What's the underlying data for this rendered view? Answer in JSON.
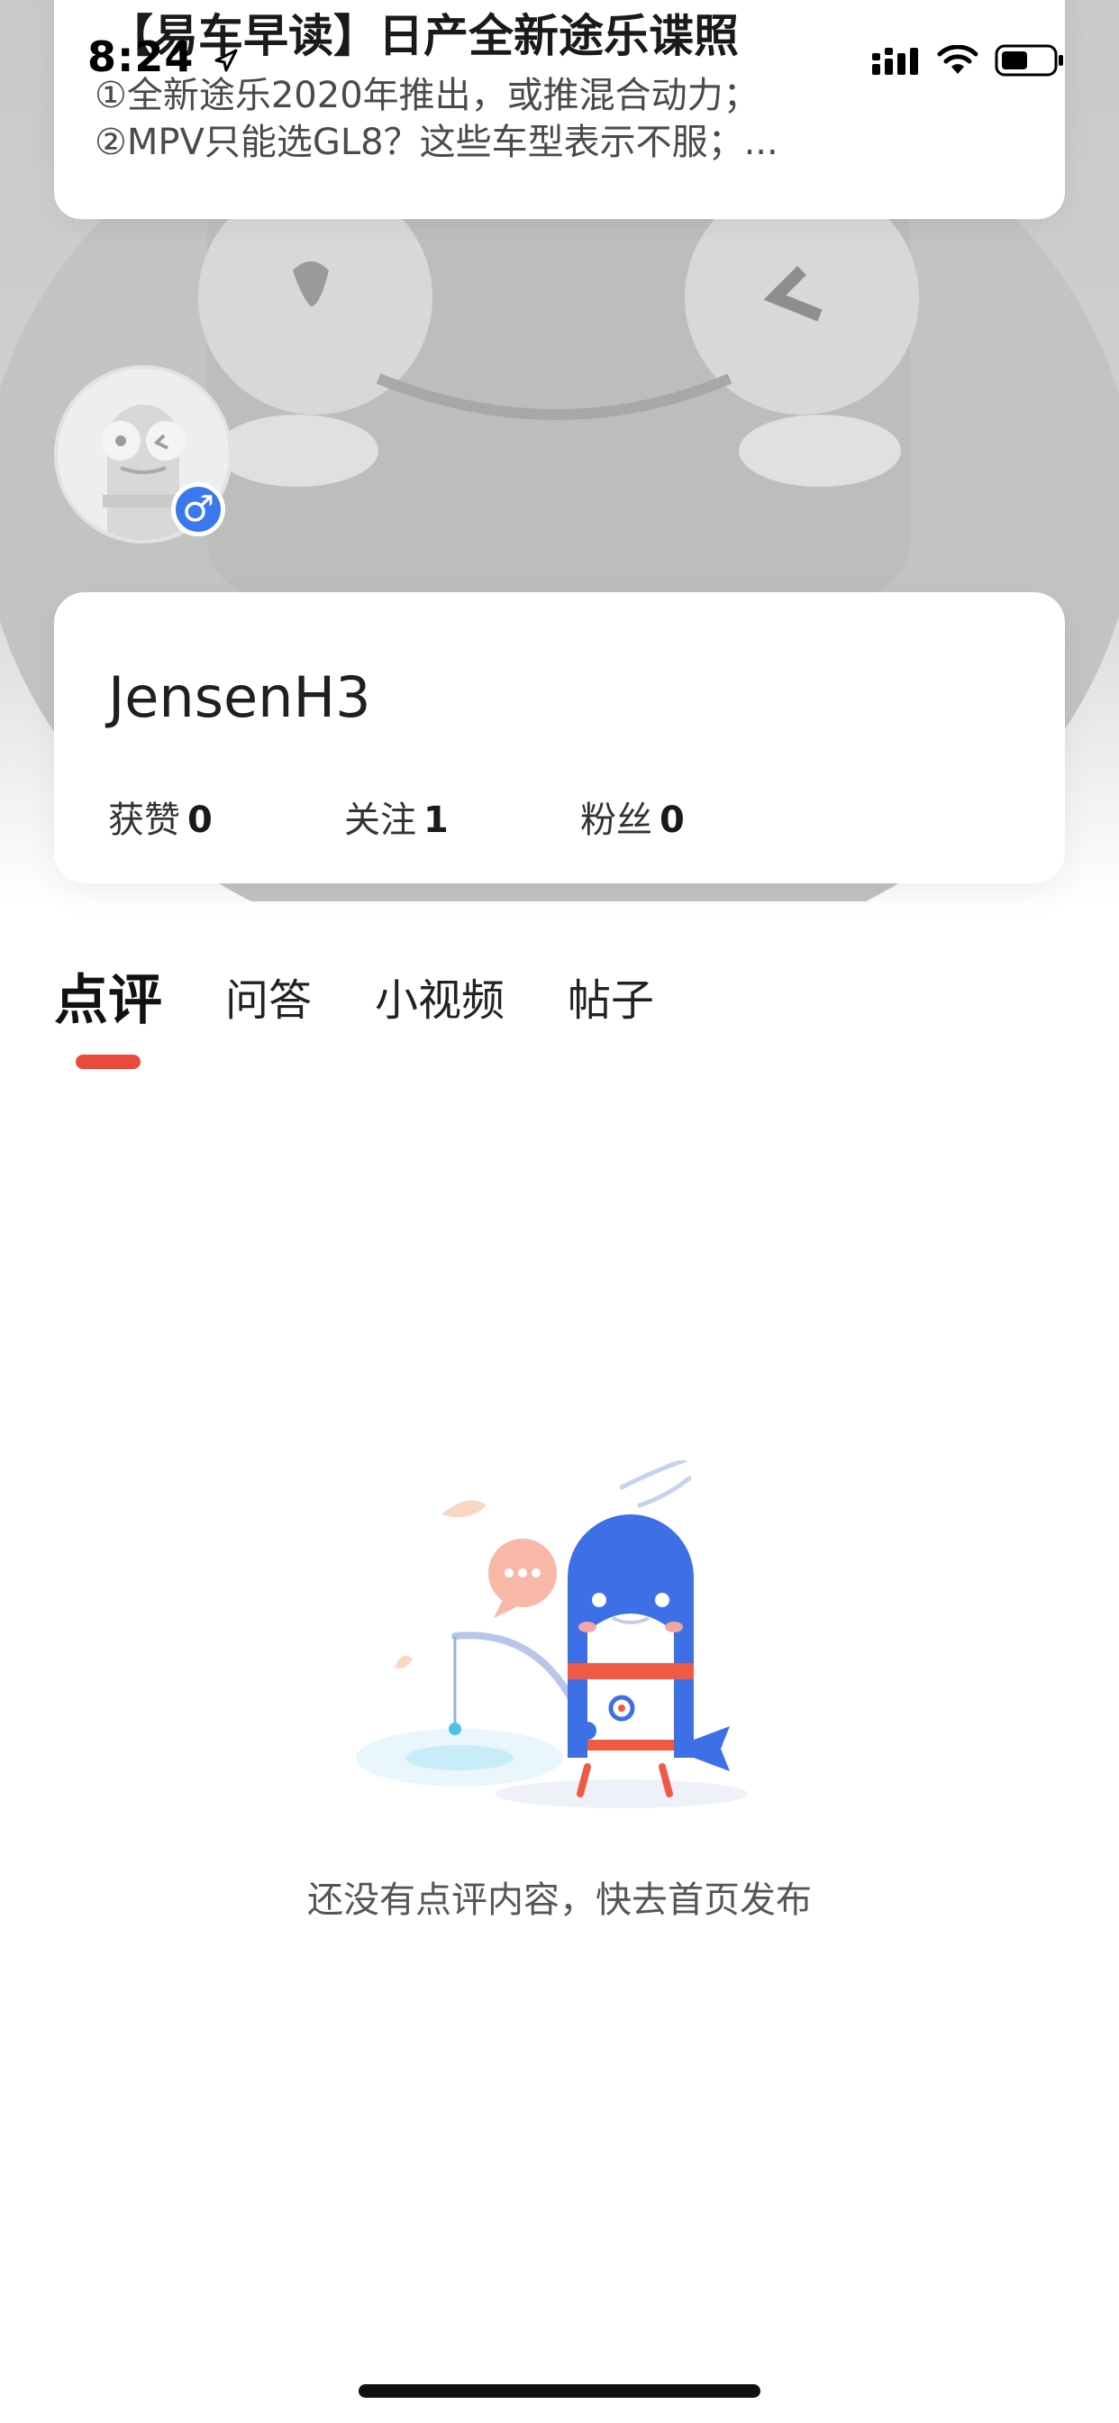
{
  "status_bar": {
    "time": "8:24"
  },
  "top_card": {
    "title": "【易车早读】日产全新途乐谍照",
    "lines": [
      "①全新途乐2020年推出，或推混合动力；",
      "②MPV只能选GL8？这些车型表示不服；..."
    ]
  },
  "profile": {
    "username": "JensenH3",
    "gender_symbol": "♂",
    "stats": [
      {
        "label": "获赞",
        "value": "0"
      },
      {
        "label": "关注",
        "value": "1"
      },
      {
        "label": "粉丝",
        "value": "0"
      }
    ]
  },
  "tabs": [
    {
      "label": "点评",
      "active": true
    },
    {
      "label": "问答",
      "active": false
    },
    {
      "label": "小视频",
      "active": false
    },
    {
      "label": "帖子",
      "active": false
    }
  ],
  "empty_state": {
    "message": "还没有点评内容，快去首页发布"
  },
  "colors": {
    "accent": "#ea4a3a",
    "gender_badge": "#3a78ee",
    "mascot_blue": "#3d6fe6"
  },
  "icons": [
    "location-arrow-icon",
    "signal-icon",
    "wifi-icon",
    "battery-icon",
    "male-icon"
  ]
}
